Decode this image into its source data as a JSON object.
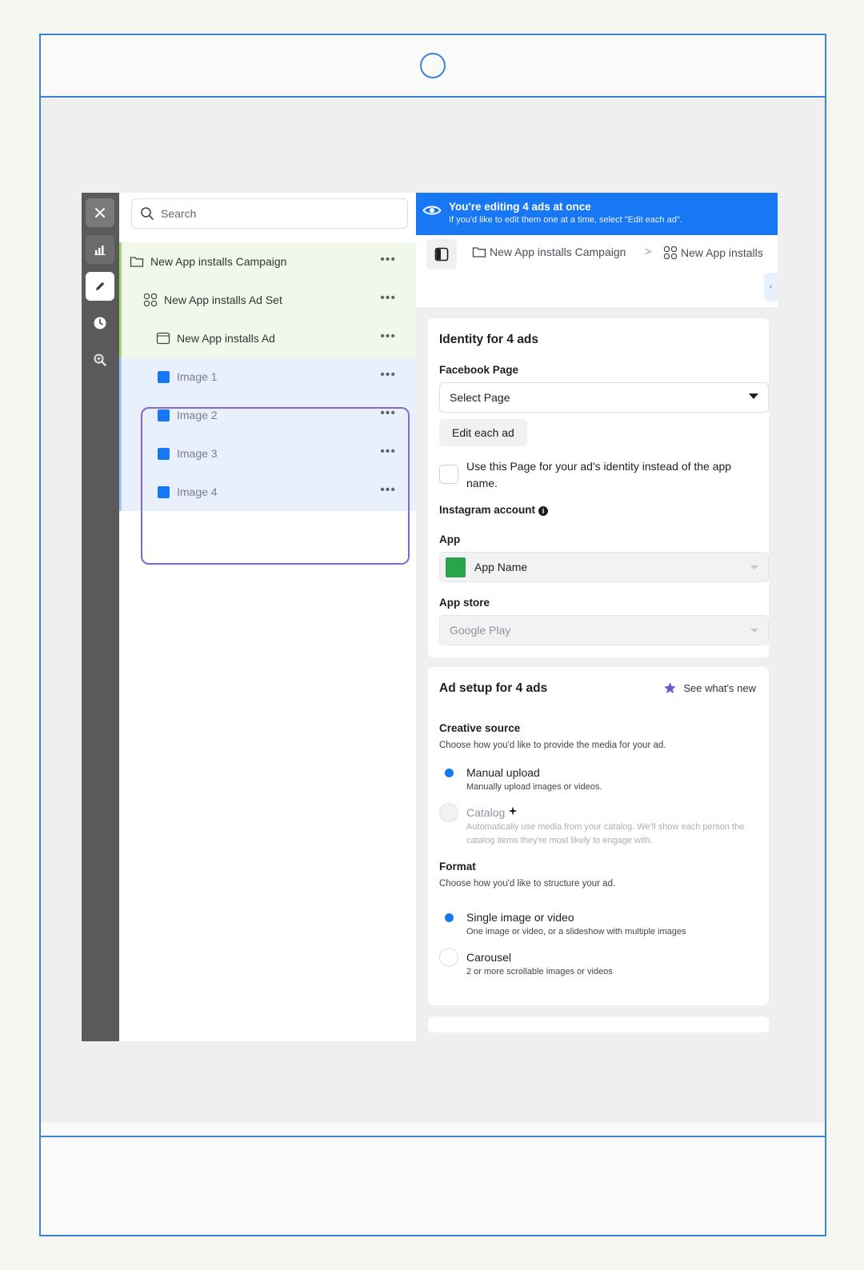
{
  "search": {
    "placeholder": "Search"
  },
  "tree": {
    "campaign": "New App installs Campaign",
    "adset": "New App installs Ad Set",
    "ad": "New App installs Ad",
    "images": [
      "Image 1",
      "Image 2",
      "Image 3",
      "Image 4"
    ],
    "more_label": "•••"
  },
  "banner": {
    "title": "You're editing 4 ads at once",
    "subtitle": "If you'd like to edit them one at a time, select \"Edit each ad\"."
  },
  "breadcrumb": {
    "campaign": "New App installs Campaign",
    "separator": ">",
    "adset": "New App installs",
    "scroll_glyph": "‹"
  },
  "identity": {
    "title": "Identity for 4 ads",
    "facebook_page_label": "Facebook Page",
    "select_page": "Select Page",
    "edit_each_ad": "Edit each ad",
    "use_page_text": "Use this Page for your ad's identity instead of the app name.",
    "instagram_label": "Instagram account",
    "info_glyph": "i",
    "app_label": "App",
    "app_name": "App Name",
    "app_store_label": "App store",
    "app_store_value": "Google Play"
  },
  "ad_setup": {
    "title": "Ad setup for 4 ads",
    "whats_new": "See what's new",
    "creative_source_label": "Creative source",
    "creative_source_hint": "Choose how you'd like to provide the media for your ad.",
    "manual_upload": "Manual upload",
    "manual_upload_sub": "Manually upload images or videos.",
    "catalog": "Catalog",
    "catalog_sub": "Automatically use media from your catalog. We'll show each person the catalog items they're most likely to engage with.",
    "format_label": "Format",
    "format_hint": "Choose how you'd like to structure your ad.",
    "single_image": "Single image or video",
    "single_image_sub": "One image or video, or a slideshow with multiple images",
    "carousel": "Carousel",
    "carousel_sub": "2 or more scrollable images or videos"
  },
  "colors": {
    "accent": "#1877f2",
    "selection_outline": "#8068cc",
    "campaign_tint": "#f1f8e9",
    "ads_tint": "#e8f0fc",
    "app_icon": "#2aa44a",
    "frame": "#3b82d9"
  },
  "icons": {
    "rail": [
      "close-icon",
      "chart-icon",
      "pencil-icon",
      "clock-icon",
      "magnifier-icon"
    ],
    "tree": [
      "folder-icon",
      "grid-icon",
      "ad-icon",
      "image-square-icon"
    ],
    "banner": "eye-icon",
    "whats_new": "star-icon",
    "catalog": "sparkle-icon"
  }
}
